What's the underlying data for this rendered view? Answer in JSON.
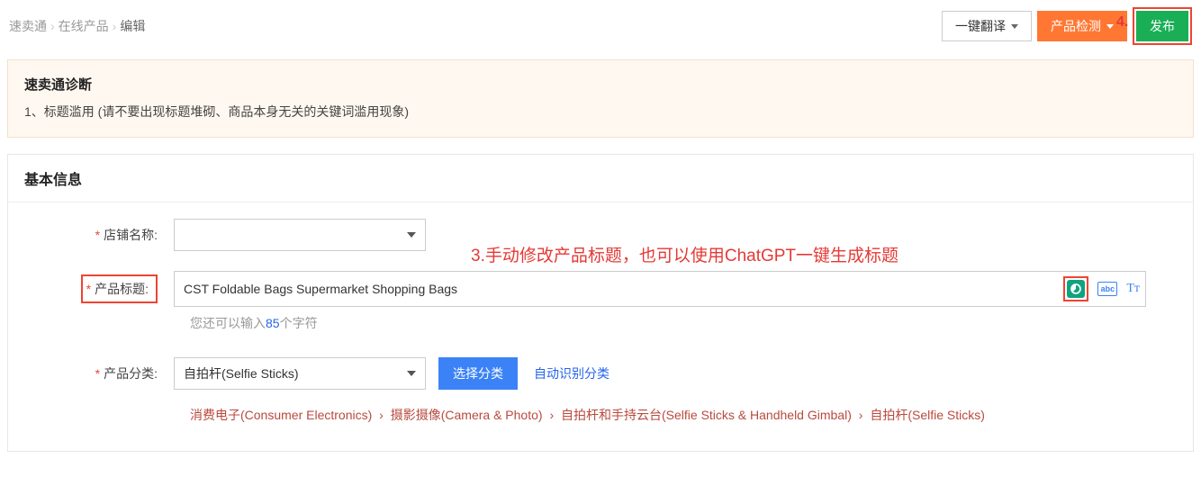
{
  "breadcrumb": {
    "a": "速卖通",
    "b": "在线产品",
    "c": "编辑"
  },
  "topButtons": {
    "translate": "一键翻译",
    "detect": "产品检测",
    "publish": "发布",
    "publishNum": "4."
  },
  "diagnostic": {
    "title": "速卖通诊断",
    "item1": "1、标题滥用 (请不要出现标题堆砌、商品本身无关的关键词滥用现象)"
  },
  "card": {
    "title": "基本信息"
  },
  "labels": {
    "storeName": "店铺名称:",
    "productTitle": "产品标题:",
    "productCategory": "产品分类:"
  },
  "annotation": "3.手动修改产品标题，也可以使用ChatGPT一键生成标题",
  "titleInput": {
    "value": "CST Foldable Bags Supermarket Shopping Bags"
  },
  "hint": {
    "prefix": "您还可以输入",
    "count": "85",
    "suffix": "个字符"
  },
  "categorySelect": {
    "value": "自拍杆(Selfie Sticks)"
  },
  "buttons": {
    "chooseCategory": "选择分类",
    "autoCategory": "自动识别分类"
  },
  "categoryPath": {
    "p1": "消费电子(Consumer Electronics)",
    "p2": "摄影摄像(Camera & Photo)",
    "p3": "自拍杆和手持云台(Selfie Sticks & Handheld Gimbal)",
    "p4": "自拍杆(Selfie Sticks)"
  },
  "icons": {
    "abc": "abc",
    "tt": "Tᴛ"
  }
}
